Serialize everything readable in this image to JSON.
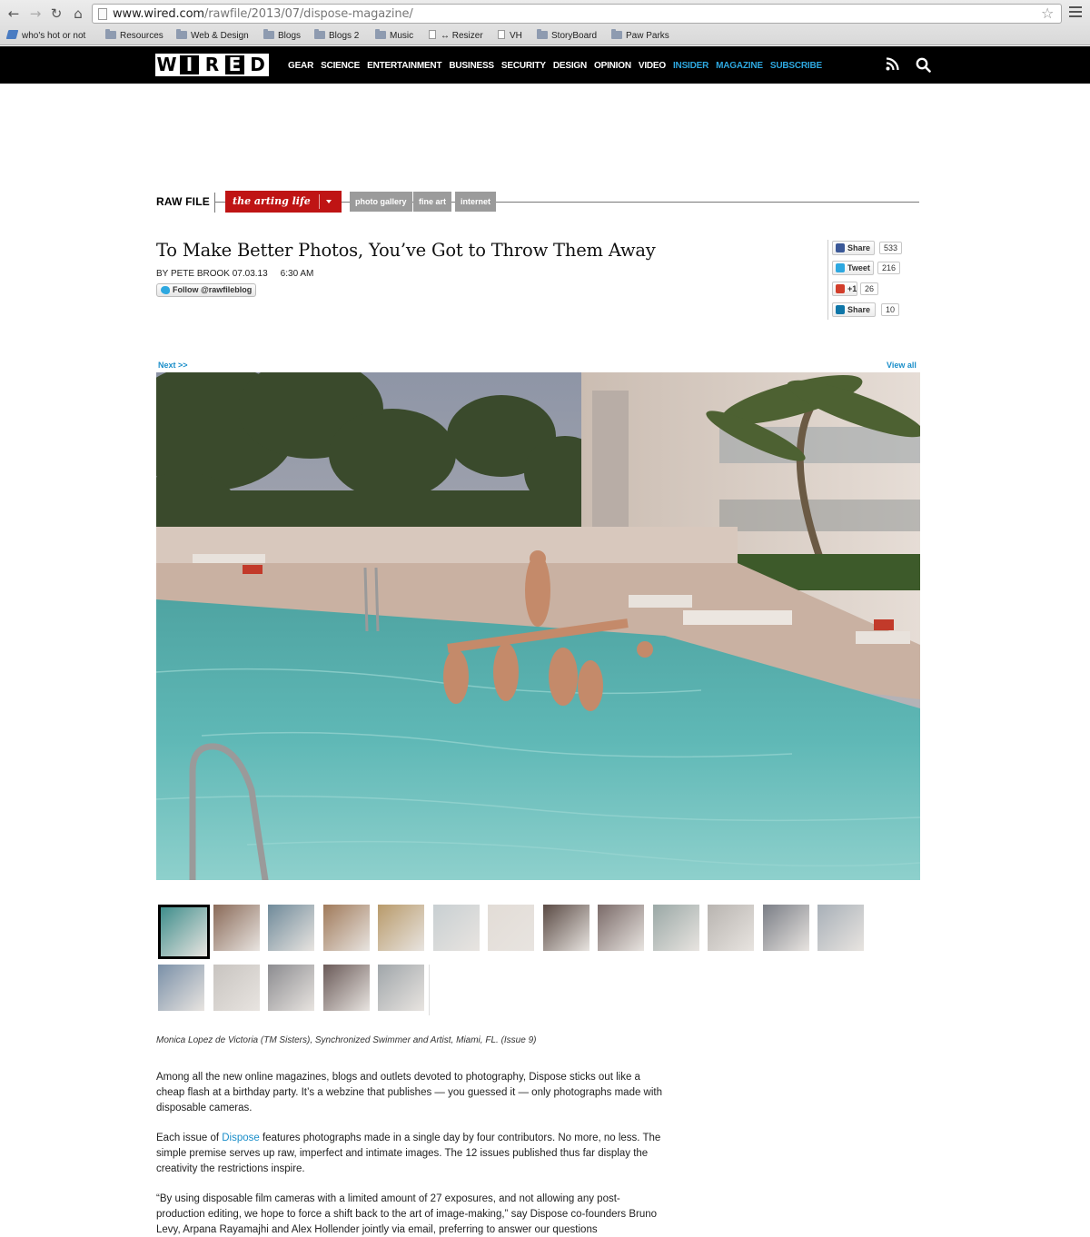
{
  "browser": {
    "url_host": "www.wired.com",
    "url_path": "/rawfile/2013/07/dispose-magazine/",
    "bookmarks": [
      {
        "label": "who's hot or not",
        "kind": "tag"
      },
      {
        "label": "Resources",
        "kind": "folder"
      },
      {
        "label": "Web & Design",
        "kind": "folder"
      },
      {
        "label": "Blogs",
        "kind": "folder"
      },
      {
        "label": "Blogs 2",
        "kind": "folder"
      },
      {
        "label": "Music",
        "kind": "folder"
      },
      {
        "label": "↔ Resizer",
        "kind": "doc"
      },
      {
        "label": "VH",
        "kind": "doc"
      },
      {
        "label": "StoryBoard",
        "kind": "folder"
      },
      {
        "label": "Paw Parks",
        "kind": "folder"
      }
    ]
  },
  "header": {
    "logo_letters": [
      "W",
      "I",
      "R",
      "E",
      "D"
    ],
    "nav": [
      {
        "label": "GEAR",
        "accent": false
      },
      {
        "label": "SCIENCE",
        "accent": false
      },
      {
        "label": "ENTERTAINMENT",
        "accent": false
      },
      {
        "label": "BUSINESS",
        "accent": false
      },
      {
        "label": "SECURITY",
        "accent": false
      },
      {
        "label": "DESIGN",
        "accent": false
      },
      {
        "label": "OPINION",
        "accent": false
      },
      {
        "label": "VIDEO",
        "accent": false
      },
      {
        "label": "INSIDER",
        "accent": true
      },
      {
        "label": "MAGAZINE",
        "accent": true
      },
      {
        "label": "SUBSCRIBE",
        "accent": true
      }
    ],
    "accent_color": "#2ea8e0"
  },
  "section": {
    "name": "RAW FILE",
    "category": "the arting life",
    "tags": [
      "photo gallery",
      "fine art",
      "internet"
    ],
    "category_color": "#bf1414"
  },
  "article": {
    "headline": "To Make Better Photos, You’ve Got to Throw Them Away",
    "byline": "BY PETE BROOK",
    "date": "07.03.13",
    "time": "6:30 AM",
    "follow_label": "Follow @rawfileblog"
  },
  "social": [
    {
      "label": "Share",
      "count": "533",
      "icon": "facebook-icon",
      "color": "#3b5998"
    },
    {
      "label": "Tweet",
      "count": "216",
      "icon": "twitter-icon",
      "color": "#2ea8e0"
    },
    {
      "label": "+1",
      "count": "26",
      "icon": "google-plus-icon",
      "color": "#d23e2b"
    },
    {
      "label": "Share",
      "count": "10",
      "icon": "linkedin-icon",
      "color": "#0e76a8"
    }
  ],
  "gallery": {
    "next_label": "Next >>",
    "view_all_label": "View all",
    "caption": "Monica Lopez de Victoria (TM Sisters), Synchronized Swimmer and Artist, Miami, FL. (Issue 9)"
  },
  "body": {
    "p1": "Among all the new online magazines, blogs and outlets devoted to photography, Dispose sticks out like a cheap flash at a birthday party. It’s a webzine that publishes — you guessed it — only photographs made with disposable cameras.",
    "p2_before": "Each issue of ",
    "p2_link": "Dispose",
    "p2_after": " features photographs made in a single day by four contributors. No more, no less. The simple premise serves up raw, imperfect and intimate images. The 12 issues published thus far display the creativity the restrictions inspire.",
    "p3": "“By using disposable film cameras with a limited amount of 27 exposures, and not allowing any post-production editing, we hope to force a shift back to the art of image-making,” say Dispose co-founders Bruno Levy, Arpana Rayamajhi and Alex Hollender jointly via email, preferring to answer our questions"
  }
}
